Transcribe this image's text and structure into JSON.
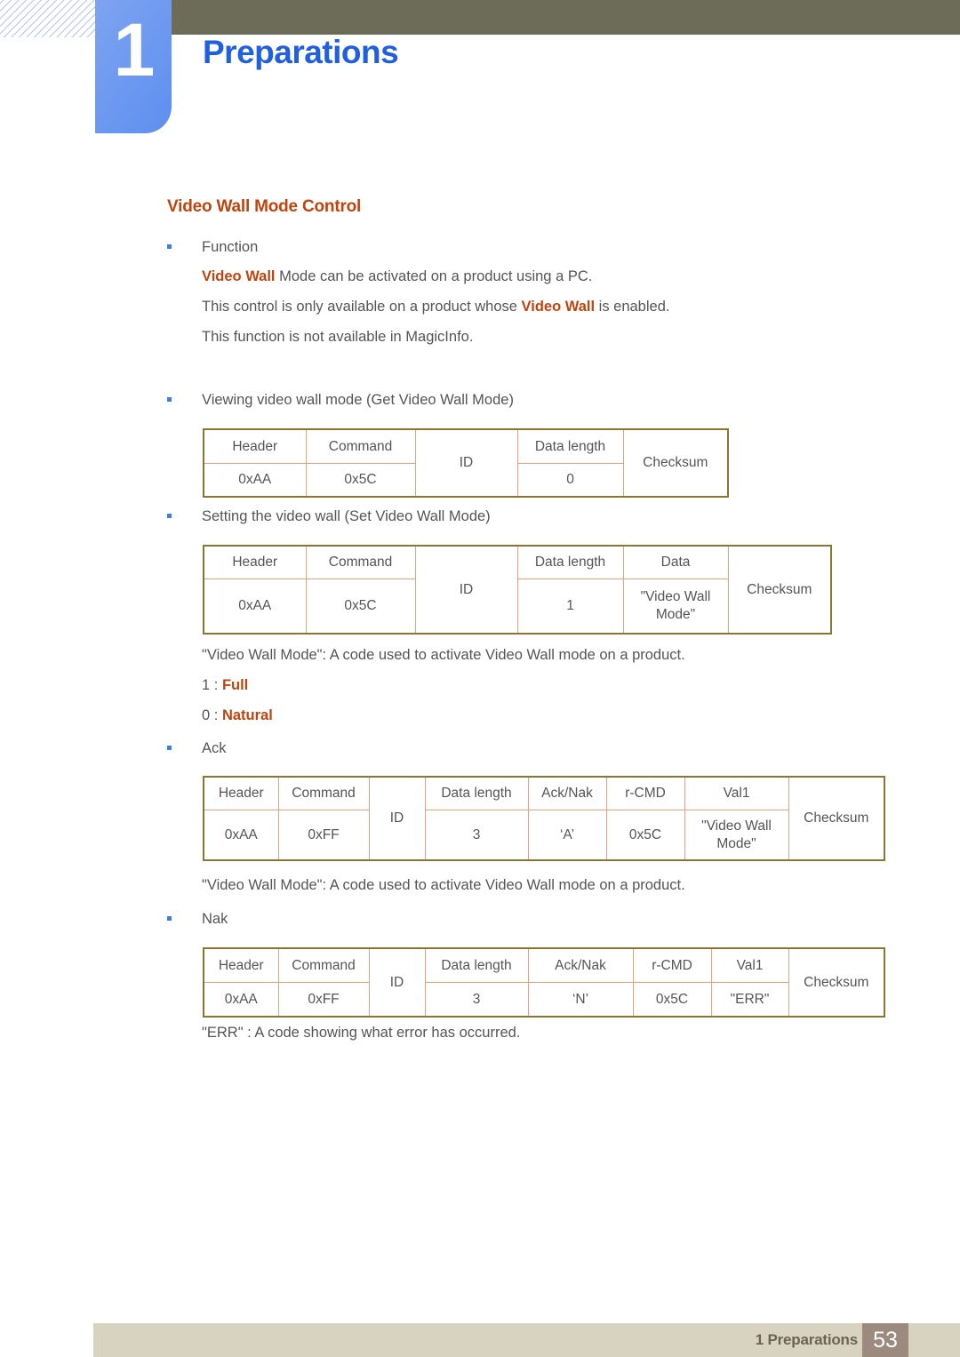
{
  "banner": {
    "chapter_number": "1",
    "chapter_title": "Preparations"
  },
  "section": {
    "heading": "Video Wall Mode Control"
  },
  "blocks": {
    "function_bullet": "Function",
    "function_line1_a": "Video Wall",
    "function_line1_b": " Mode can be activated on a product using a PC.",
    "function_line2_a": "This control is only available on a product whose ",
    "function_line2_b": "Video Wall",
    "function_line2_c": " is enabled.",
    "function_line3": "This function is not available in MagicInfo.",
    "get_bullet": "Viewing video wall mode (Get Video Wall Mode)",
    "set_bullet": "Setting the video wall (Set Video Wall Mode)",
    "code_note_1": "\"Video Wall Mode\": A code used to activate Video Wall mode on a product.",
    "code_value_full_key": "1 : ",
    "code_value_full_val": "Full",
    "code_value_natural_key": "0 : ",
    "code_value_natural_val": "Natural",
    "ack_bullet": "Ack",
    "code_note_2": "\"Video Wall Mode\": A code used to activate Video Wall mode on a product.",
    "nak_bullet": "Nak",
    "err_note": "\"ERR\" : A code showing what error has occurred."
  },
  "tables": {
    "get": {
      "headers": [
        "Header",
        "Command",
        "ID",
        "Data length",
        "Checksum"
      ],
      "values": [
        "0xAA",
        "0x5C",
        "ID",
        "0",
        "Checksum"
      ]
    },
    "set": {
      "headers": [
        "Header",
        "Command",
        "ID",
        "Data length",
        "Data",
        "Checksum"
      ],
      "values": [
        "0xAA",
        "0x5C",
        "ID",
        "1",
        "\"Video Wall Mode\"",
        "Checksum"
      ]
    },
    "ack": {
      "headers": [
        "Header",
        "Command",
        "ID",
        "Data length",
        "Ack/Nak",
        "r-CMD",
        "Val1",
        "Checksum"
      ],
      "values": [
        "0xAA",
        "0xFF",
        "ID",
        "3",
        "‘A’",
        "0x5C",
        "\"Video Wall Mode\"",
        "Checksum"
      ]
    },
    "nak": {
      "headers": [
        "Header",
        "Command",
        "ID",
        "Data length",
        "Ack/Nak",
        "r-CMD",
        "Val1",
        "Checksum"
      ],
      "values": [
        "0xAA",
        "0xFF",
        "ID",
        "3",
        "‘N’",
        "0x5C",
        "\"ERR\"",
        "Checksum"
      ]
    }
  },
  "footer": {
    "label": "1 Preparations",
    "page": "53"
  },
  "colors": {
    "accent_orange": "#c1440e",
    "chapter_blue": "#1f5fe0",
    "badge_blue": "#6f9af0",
    "olive": "#6d6c58",
    "footer_beige": "#d8d2c0",
    "footer_brown": "#9b8a7d",
    "table_outer_border": "#8d7430",
    "table_inner_border": "#e8a07e"
  }
}
